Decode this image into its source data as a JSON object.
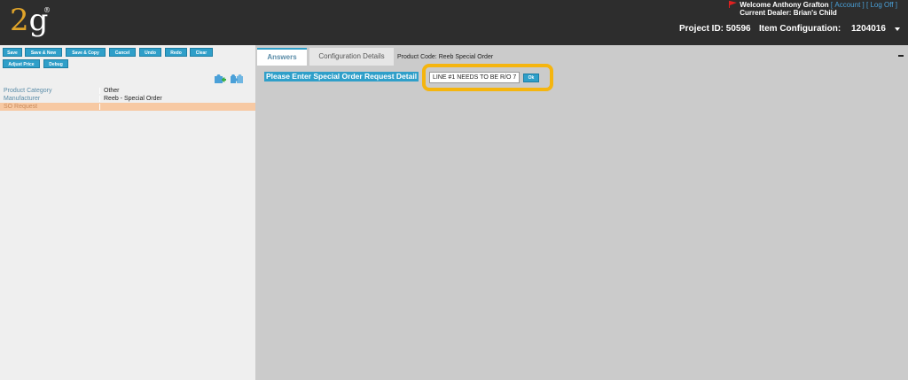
{
  "header": {
    "logo_2": "2",
    "logo_g": "g",
    "logo_reg": "®",
    "welcome": "Welcome Anthony Grafton",
    "account_link": "Account",
    "logoff_link": "Log Off",
    "current_dealer": "Current Dealer: Brian's Child",
    "project_id": "Project ID: 50596",
    "item_config_label": "Item Configuration:",
    "item_config_value": "1204016",
    "flag_color": "#e02020"
  },
  "toolbar": {
    "save": "Save",
    "save_new": "Save & New",
    "save_copy": "Save & Copy",
    "cancel": "Cancel",
    "undo": "Undo",
    "redo": "Redo",
    "clear": "Clear",
    "adjust_price": "Adjust Price",
    "debug": "Debug"
  },
  "attributes": [
    {
      "key": "Product Category",
      "value": "Other"
    },
    {
      "key": "Manufacturer",
      "value": "Reeb - Special Order"
    },
    {
      "key": "SO Request",
      "value": ""
    }
  ],
  "tabs": {
    "answers": "Answers",
    "configuration_details": "Configuration Details"
  },
  "product_code": "Product Code: Reeb Special Order",
  "question": {
    "label": "Please Enter Special Order Request Detail",
    "answer_value": "LINE #1 NEEDS TO BE R/O 7",
    "ok": "Ok"
  },
  "colors": {
    "accent": "#2f9fc9",
    "highlight": "#f5b50f",
    "header_bg": "#2d2d2d"
  }
}
